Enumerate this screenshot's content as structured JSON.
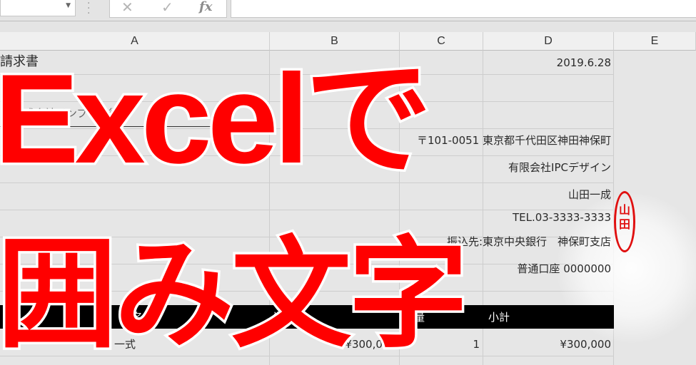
{
  "formula_bar": {
    "cancel_glyph": "✕",
    "enter_glyph": "✓",
    "fx_label": "fx"
  },
  "columns": [
    "A",
    "B",
    "C",
    "D",
    "E"
  ],
  "sheet": {
    "title": "請求書",
    "date": "2019.6.28",
    "addressee": "株式会社インプレス御中",
    "sender": {
      "address": "〒101-0051 東京都千代田区神田神保町",
      "company": "有限会社IPCデザイン",
      "name": "山田一成",
      "tel": "TEL.03-3333-3333",
      "bank": "振込先:東京中央銀行　神保町支店",
      "account": "普通口座 0000000"
    },
    "table_header": {
      "item": "品名",
      "unit_price": "単価",
      "qty": "数量",
      "subtotal": "小計"
    },
    "row1": {
      "item": "一式",
      "unit_price": "¥300,000",
      "qty": "1",
      "subtotal": "¥300,000"
    }
  },
  "stamp": {
    "text": "山田"
  },
  "overlay": {
    "line1": "Excelで",
    "line2": "囲み文字"
  },
  "colors": {
    "overlay_red": "#ff0000",
    "stamp_red": "#e01010",
    "header_black": "#000000"
  }
}
